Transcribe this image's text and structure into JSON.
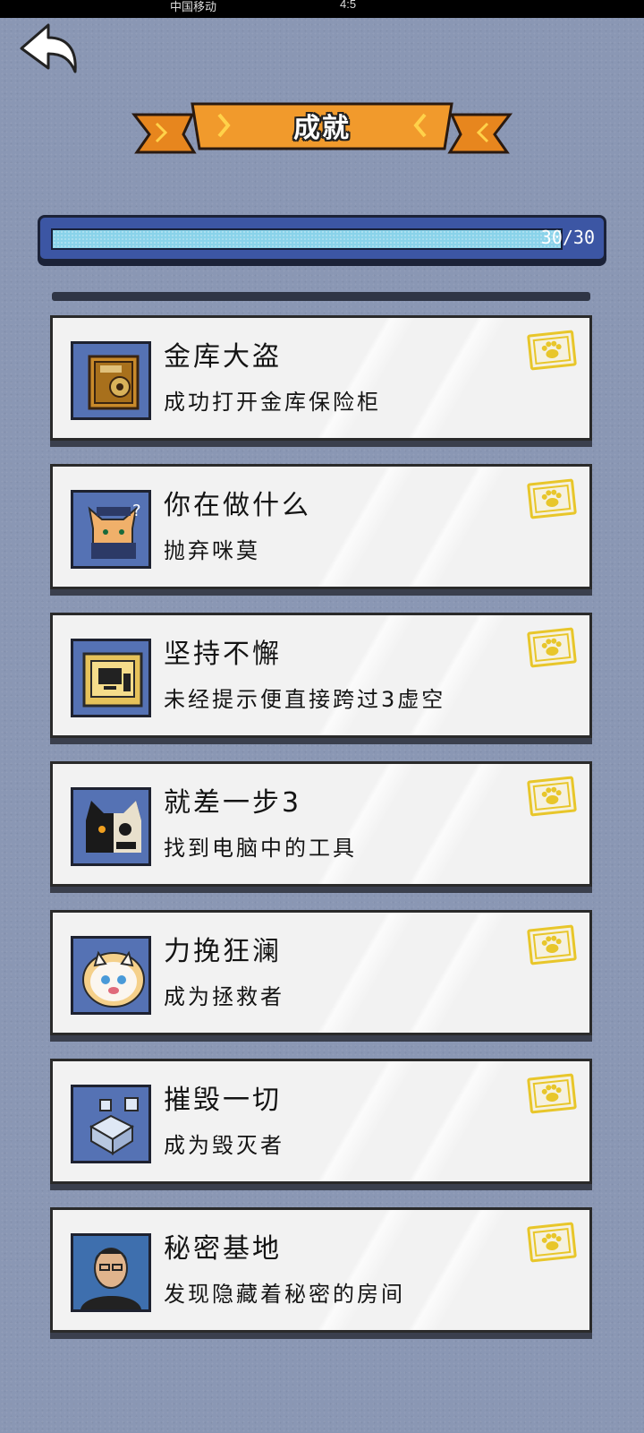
{
  "status_bar": {
    "carrier": "中国移动",
    "time": "4:5"
  },
  "header": {
    "title": "成就"
  },
  "progress": {
    "label": "30/30",
    "current": 30,
    "total": 30
  },
  "achievements": [
    {
      "title": "金库大盗",
      "description": "成功打开金库保险柜",
      "icon": "safe-icon"
    },
    {
      "title": "你在做什么",
      "description": "抛弃咪莫",
      "icon": "cat-police-icon"
    },
    {
      "title": "坚持不懈",
      "description": "未经提示便直接跨过3虚空",
      "icon": "computer-icon"
    },
    {
      "title": "就差一步3",
      "description": "找到电脑中的工具",
      "icon": "cat-skull-icon"
    },
    {
      "title": "力挽狂澜",
      "description": "成为拯救者",
      "icon": "white-cat-icon"
    },
    {
      "title": "摧毁一切",
      "description": "成为毁灭者",
      "icon": "cubes-icon"
    },
    {
      "title": "秘密基地",
      "description": "发现隐藏着秘密的房间",
      "icon": "person-icon"
    }
  ],
  "colors": {
    "badge": "#e8c62a",
    "progress_fill": "#8ad3ea",
    "banner": "#f19a2c"
  }
}
